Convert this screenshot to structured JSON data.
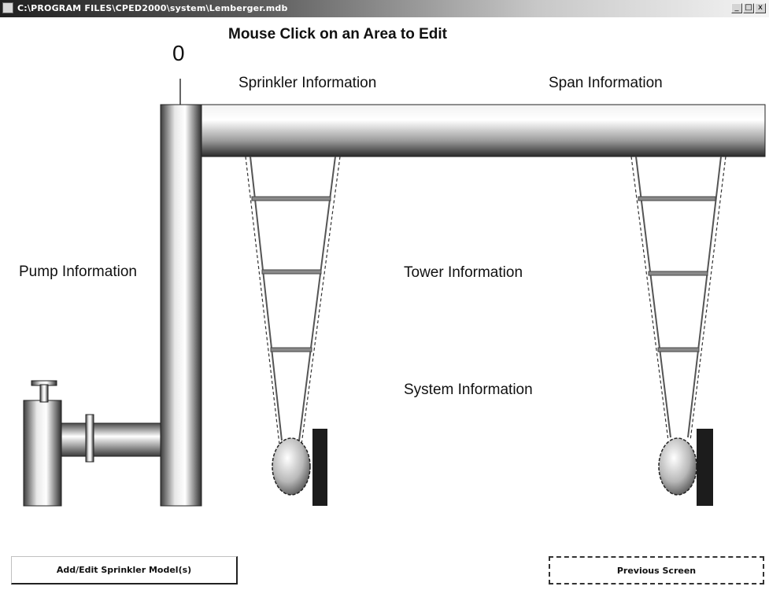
{
  "window": {
    "title": "C:\\PROGRAM FILES\\CPED2000\\system\\Lemberger.mdb",
    "minimize_glyph": "_",
    "maximize_glyph": "□",
    "close_glyph": "x"
  },
  "header": {
    "instruction": "Mouse Click on an Area to Edit"
  },
  "diagram": {
    "gauge_value": "0",
    "areas": {
      "sprinkler": "Sprinkler Information",
      "span": "Span Information",
      "pump": "Pump Information",
      "tower": "Tower Information",
      "system": "System Information"
    }
  },
  "buttons": {
    "add_edit_sprinkler": "Add/Edit Sprinkler Model(s)",
    "previous_screen": "Previous Screen"
  }
}
